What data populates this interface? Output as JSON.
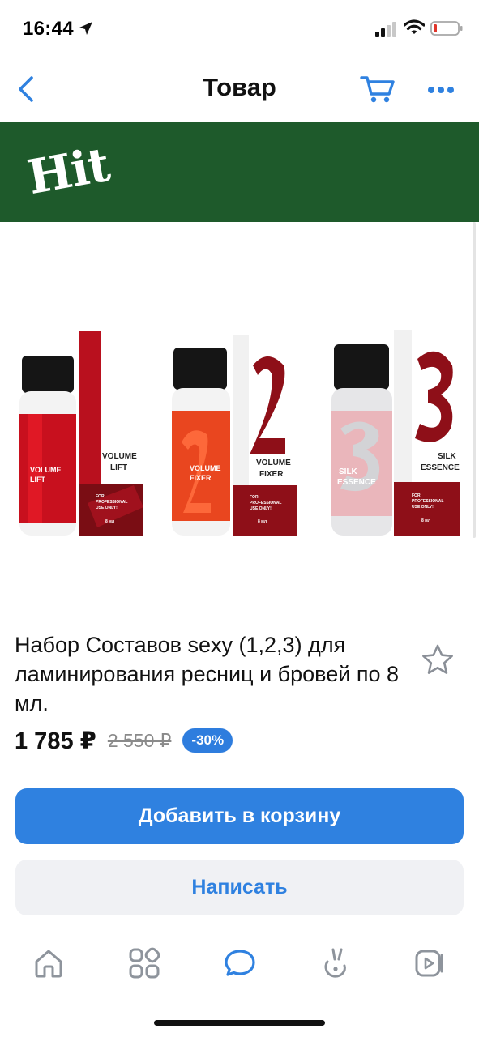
{
  "status_bar": {
    "time": "16:44"
  },
  "nav": {
    "title": "Товар",
    "back_icon": "chevron-left-icon",
    "cart_icon": "cart-icon",
    "more_icon": "more-dots-icon"
  },
  "gallery": {
    "banner_text": "Hit",
    "banner_color": "#1e5a2b",
    "products": [
      {
        "number": "1",
        "name_line1": "VOLUME",
        "name_line2": "LIFT",
        "bottle_line1": "VOLUME",
        "bottle_line2": "LIFT",
        "volume": "8 мл",
        "pro_line1": "FOR",
        "pro_line2": "PROFESSIONAL",
        "pro_line3": "USE ONLY!"
      },
      {
        "number": "2",
        "name_line1": "VOLUME",
        "name_line2": "FIXER",
        "bottle_line1": "VOLUME",
        "bottle_line2": "FIXER",
        "volume": "8 мл",
        "pro_line1": "FOR",
        "pro_line2": "PROFESSIONAL",
        "pro_line3": "USE ONLY!"
      },
      {
        "number": "3",
        "name_line1": "SILK",
        "name_line2": "ESSENCE",
        "bottle_line1": "SILK",
        "bottle_line2": "ESSENCE",
        "volume": "8 мл",
        "pro_line1": "FOR",
        "pro_line2": "PROFESSIONAL",
        "pro_line3": "USE ONLY!"
      }
    ],
    "pager": {
      "total": 2,
      "active": 1
    }
  },
  "product": {
    "title": "Набор Составов sexy (1,2,3) для ламинирования ресниц и бровей по 8 мл.",
    "price": "1 785 ₽",
    "old_price": "2 550 ₽",
    "discount": "-30%",
    "favorite_icon": "star-outline-icon"
  },
  "actions": {
    "add_to_cart": "Добавить в корзину",
    "write": "Написать"
  },
  "tab_bar": {
    "items": [
      "home-icon",
      "services-grid-icon",
      "messages-icon",
      "clips-icon",
      "video-icon"
    ],
    "active_index": 2
  },
  "colors": {
    "accent": "#2f81e0",
    "discount_badge": "#2e7dde",
    "secondary_button_bg": "#f0f1f4",
    "product_red": "#c8101e",
    "product_dark_red": "#7a0d14",
    "product_pink": "#e8a7ae"
  }
}
